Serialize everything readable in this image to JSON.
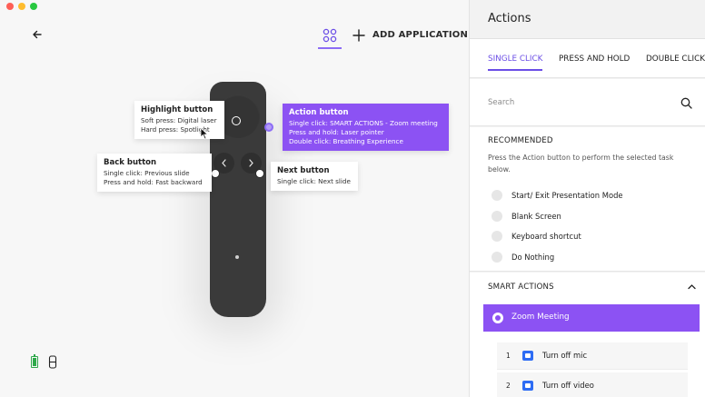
{
  "header": {
    "add_application": "ADD APPLICATION"
  },
  "tooltips": {
    "highlight": {
      "title": "Highlight button",
      "line1": "Soft press: Digital laser",
      "line2": "Hard press: Spotlight"
    },
    "action": {
      "title": "Action button",
      "line1": "Single click: SMART ACTIONS - Zoom meeting",
      "line2": "Press and hold: Laser pointer",
      "line3": "Double click: Breathing Experience"
    },
    "back": {
      "title": "Back button",
      "line1": "Single click: Previous slide",
      "line2": "Press and hold: Fast backward"
    },
    "next": {
      "title": "Next button",
      "line1": "Single click: Next slide"
    }
  },
  "panel": {
    "title": "Actions",
    "tabs": [
      {
        "label": "SINGLE CLICK",
        "active": true
      },
      {
        "label": "PRESS AND HOLD",
        "active": false
      },
      {
        "label": "DOUBLE CLICK",
        "active": false
      }
    ],
    "search": {
      "placeholder": "Search",
      "value": ""
    },
    "recommended": {
      "title": "RECOMMENDED",
      "description": "Press the Action button to perform the selected task below.",
      "options": [
        "Start/ Exit Presentation Mode",
        "Blank Screen",
        "Keyboard shortcut",
        "Do Nothing"
      ]
    },
    "smart_actions": {
      "title": "SMART ACTIONS",
      "selected": "Zoom Meeting",
      "steps": [
        {
          "num": "1",
          "label": "Turn off mic"
        },
        {
          "num": "2",
          "label": "Turn off video"
        }
      ]
    }
  },
  "colors": {
    "accent": "#8c52f3",
    "tab_active": "#6b4ee6",
    "battery": "#2ea84a",
    "zoom_blue": "#2d6cf4"
  }
}
